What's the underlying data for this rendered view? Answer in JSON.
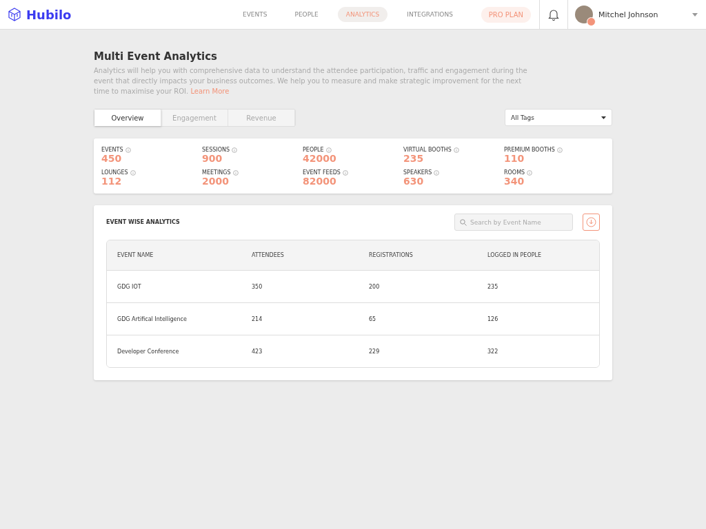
{
  "brand": {
    "name": "Hubilo"
  },
  "nav": [
    {
      "label": "EVENTS",
      "selected": false
    },
    {
      "label": "PEOPLE",
      "selected": false
    },
    {
      "label": "ANALYTICS",
      "selected": true
    },
    {
      "label": "INTEGRATIONS",
      "selected": false
    }
  ],
  "plan_button": "PRO PLAN",
  "user": {
    "name": "Mitchel Johnson"
  },
  "page": {
    "title": "Multi Event Analytics",
    "description": "Analytics will help you with comprehensive data to understand the attendee participation, traffic and engagement during the event that directly impacts your business outcomes. We help you to measure and make strategic improvement for the next time to maximise your ROI.",
    "link": "Learn More"
  },
  "tabs": [
    {
      "label": "Overview",
      "selected": true
    },
    {
      "label": "Engagement",
      "selected": false
    },
    {
      "label": "Revenue",
      "selected": false
    }
  ],
  "tag_filter": "All Tags",
  "stats": [
    {
      "label": "EVENTS",
      "value": "450"
    },
    {
      "label": "SESSIONS",
      "value": "900"
    },
    {
      "label": "PEOPLE",
      "value": "42000"
    },
    {
      "label": "VIRTUAL BOOTHS",
      "value": "235"
    },
    {
      "label": "PREMIUM BOOTHS",
      "value": "110"
    },
    {
      "label": "LOUNGES",
      "value": "112"
    },
    {
      "label": "MEETINGS",
      "value": "2000"
    },
    {
      "label": "EVENT FEEDS",
      "value": "82000"
    },
    {
      "label": "SPEAKERS",
      "value": "630"
    },
    {
      "label": "ROOMS",
      "value": "340"
    }
  ],
  "event_table": {
    "title": "EVENT WISE ANALYTICS",
    "search": {
      "placeholder": "Search by Event Name"
    },
    "columns": [
      "EVENT NAME",
      "ATTENDEES",
      "REGISTRATIONS",
      "LOGGED IN PEOPLE"
    ],
    "rows": [
      [
        "GDG IOT",
        "350",
        "200",
        "235"
      ],
      [
        "GDG Artifical Intelligence",
        "214",
        "65",
        "126"
      ],
      [
        "Developer Conference",
        "423",
        "229",
        "322"
      ]
    ]
  }
}
